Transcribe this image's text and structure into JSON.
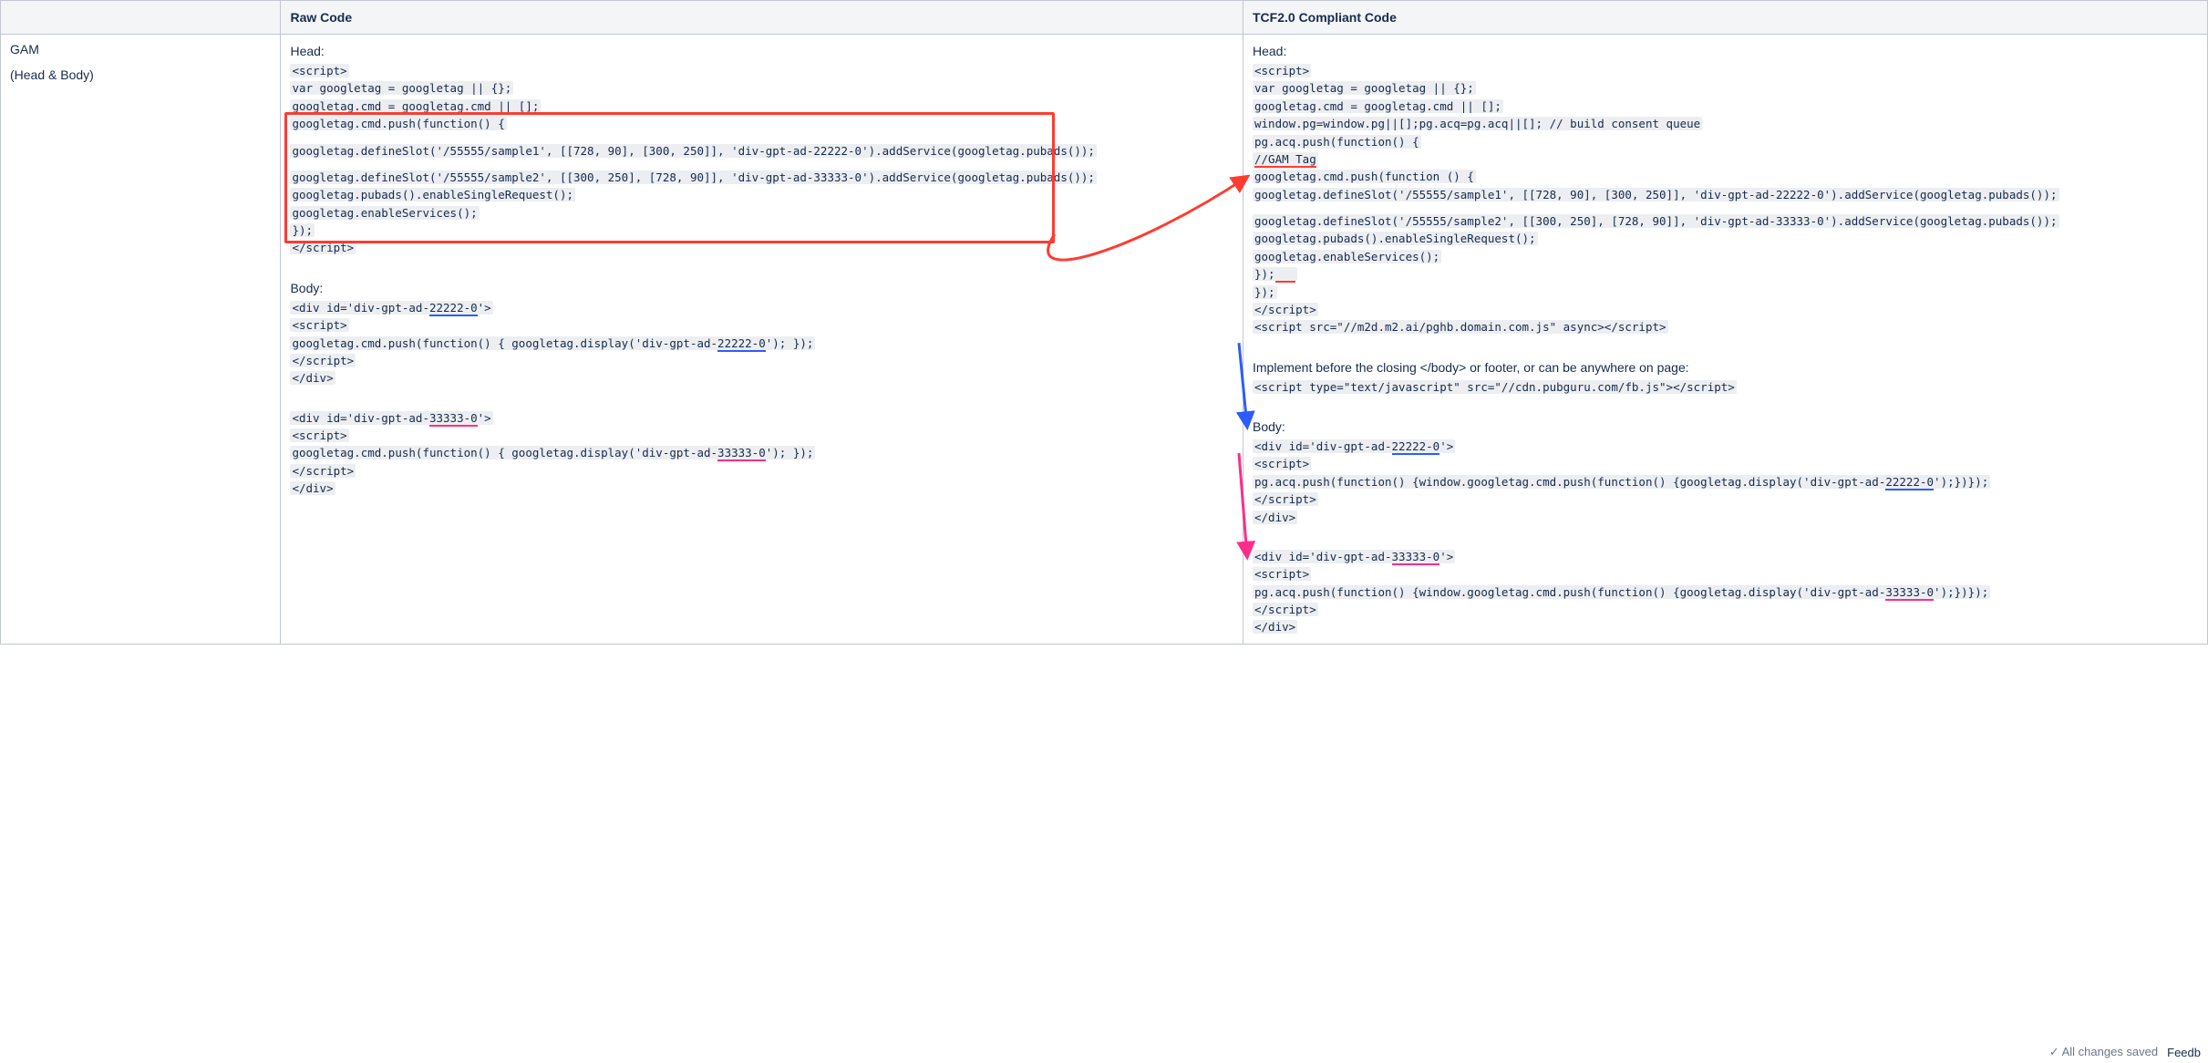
{
  "headers": {
    "col1": "",
    "col2": "Raw Code",
    "col3": "TCF2.0 Compliant Code"
  },
  "row_label": {
    "title": "GAM",
    "sub": "(Head & Body)"
  },
  "raw": {
    "head_label": "Head:",
    "body_label": "Body:",
    "lines": {
      "l1": "<script>",
      "l2": "var googletag = googletag || {};",
      "l3": "googletag.cmd = googletag.cmd || [];",
      "l4": "googletag.cmd.push(function() {",
      "l5a": "googletag.defineSlot('/55555/sample1', [[728, 90], [300, 250]], 'div-gpt-ad-22222-0').addService(googletag.pubads());",
      "l6a": "googletag.defineSlot('/55555/sample2', [[300, 250], [728, 90]], 'div-gpt-ad-33333-0').addService(googletag.pubads());",
      "l7": "googletag.pubads().enableSingleRequest();",
      "l8": "googletag.enableServices();",
      "l9": "});",
      "l10": "</script>",
      "b1a": "<div id='div-gpt-ad-",
      "b1b": "22222-0",
      "b1c": "'>",
      "b2": "<script>",
      "b3a": "googletag.cmd.push(function() { googletag.display('div-gpt-ad-",
      "b3b": "22222-0",
      "b3c": "'); });",
      "b4": "</script>",
      "b5": "</div>",
      "b6a": "<div id='div-gpt-ad-",
      "b6b": "33333-0",
      "b6c": "'>",
      "b7": "<script>",
      "b8a": "googletag.cmd.push(function() { googletag.display('div-gpt-ad-",
      "b8b": "33333-0",
      "b8c": "'); });",
      "b9": "</script>",
      "b10": "</div>"
    }
  },
  "tcf": {
    "head_label": "Head:",
    "body_label": "Body:",
    "implement_note": "Implement before the closing </body> or footer, or can be anywhere on page:",
    "lines": {
      "l1": "<script>",
      "l2": "var googletag = googletag || {};",
      "l3": "googletag.cmd = googletag.cmd || [];",
      "l4": "window.pg=window.pg||[];pg.acq=pg.acq||[]; // build consent queue",
      "l5": "pg.acq.push(function() {",
      "l6": "//GAM Tag",
      "l7": "googletag.cmd.push(function () {",
      "l8a": "googletag.defineSlot('/55555/sample1', [[728, 90], [300, 250]], 'div-gpt-ad-22222-0').addService(googletag.pubads());",
      "l9a": "googletag.defineSlot('/55555/sample2', [[300, 250], [728, 90]], 'div-gpt-ad-33333-0').addService(googletag.pubads());",
      "l10": "googletag.pubads().enableSingleRequest();",
      "l11": "googletag.enableServices();",
      "l12": "});",
      "l13": "});",
      "l14": "</script>",
      "l15": "<script src=\"//m2d.m2.ai/pghb.domain.com.js\" async></script>",
      "impl": "<script type=\"text/javascript\" src=\"//cdn.pubguru.com/fb.js\"></script>",
      "b1a": "<div id='div-gpt-ad-",
      "b1b": "22222-0",
      "b1c": "'>",
      "b2": "<script>",
      "b3a": "pg.acq.push(function() {window.googletag.cmd.push(function() {googletag.display('div-gpt-ad-",
      "b3b": "22222-0",
      "b3c": "');})});",
      "b4": "</script>",
      "b5": "</div>",
      "b6a": "<div id='div-gpt-ad-",
      "b6b": "33333-0",
      "b6c": "'>",
      "b7": "<script>",
      "b8a": "pg.acq.push(function() {window.googletag.cmd.push(function() {googletag.display('div-gpt-ad-",
      "b8b": "33333-0",
      "b8c": "');})});",
      "b9": "</script>",
      "b10": "</div>"
    }
  },
  "footer": {
    "saved": "All changes saved",
    "feedback": "Feedb"
  }
}
